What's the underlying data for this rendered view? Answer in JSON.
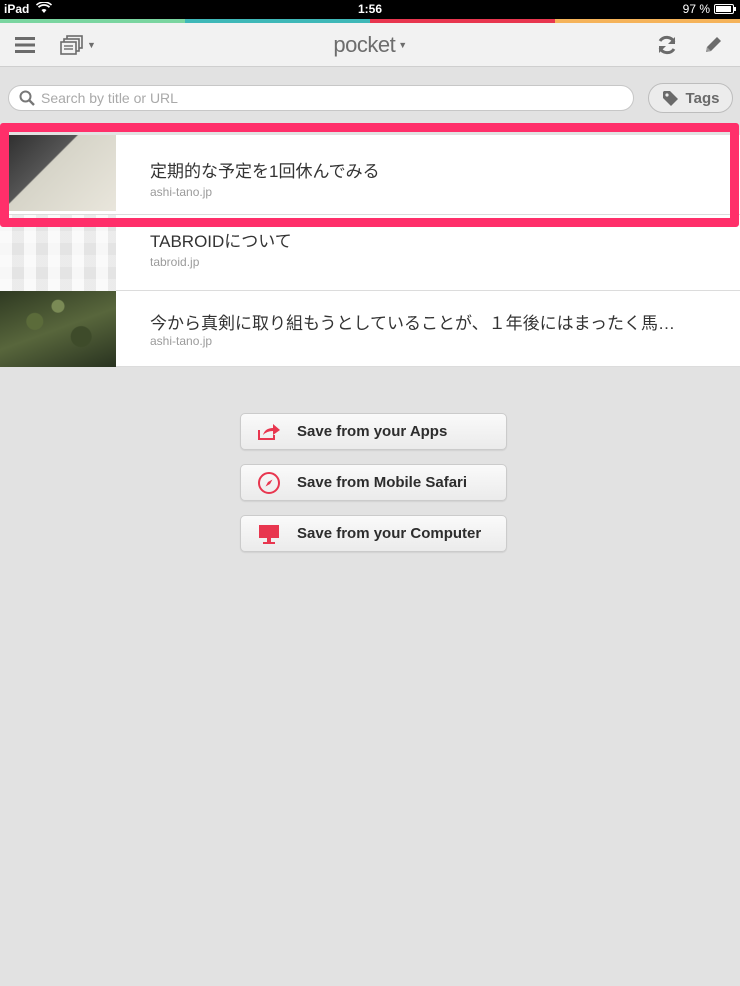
{
  "status_bar": {
    "device": "iPad",
    "time": "1:56",
    "battery": "97 %"
  },
  "nav": {
    "title": "pocket",
    "menu_icon": "hamburger-icon",
    "views_icon": "stack-icon",
    "sync_icon": "refresh-icon",
    "edit_icon": "pencil-icon"
  },
  "search": {
    "placeholder": "Search by title or URL",
    "value": ""
  },
  "tags": {
    "label": "Tags"
  },
  "items": [
    {
      "title": "定期的な予定を1回休んでみる",
      "domain": "ashi-tano.jp"
    },
    {
      "title": "TABROIDについて",
      "domain": "tabroid.jp"
    },
    {
      "title": "今から真剣に取り組もうとしていることが、１年後にはまったく馬…",
      "domain": "ashi-tano.jp"
    }
  ],
  "save_options": [
    {
      "label": "Save from your Apps",
      "icon": "share-arrow-icon"
    },
    {
      "label": "Save from Mobile Safari",
      "icon": "compass-icon"
    },
    {
      "label": "Save from your Computer",
      "icon": "monitor-icon"
    }
  ],
  "colors": {
    "accent": "#e8364f",
    "highlight": "#ff2f6a",
    "stripe": [
      "#7ad5a0",
      "#3fb8b8",
      "#e8364f",
      "#f5b35a"
    ]
  }
}
